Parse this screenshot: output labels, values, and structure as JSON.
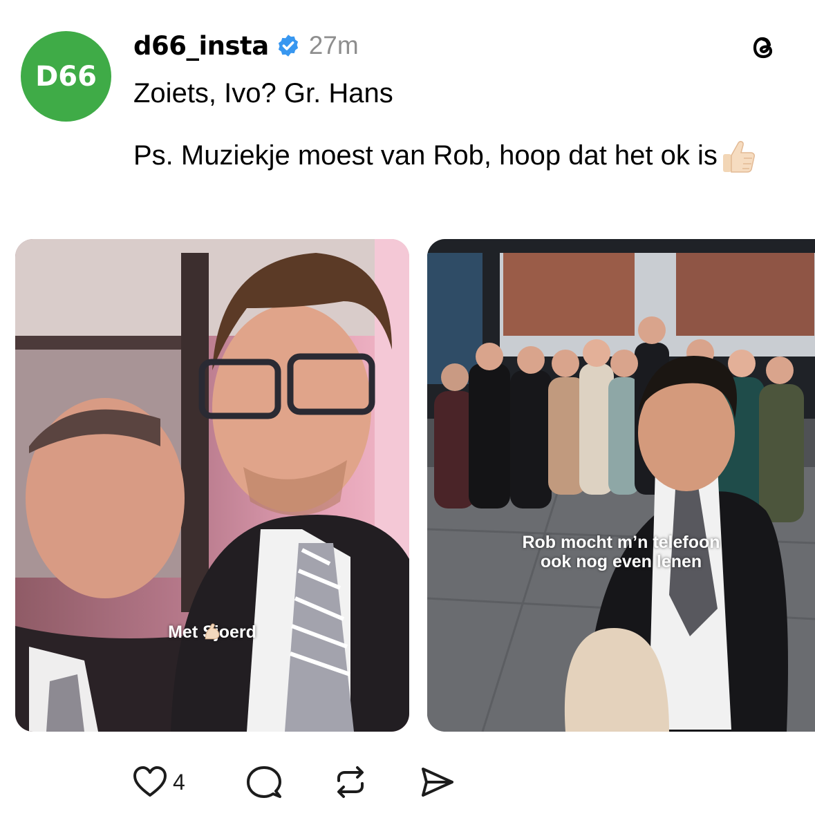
{
  "post": {
    "avatar_text": "D66",
    "avatar_color": "#3fab47",
    "username": "d66_insta",
    "verified_icon": "verified-badge-icon",
    "verified_color": "#3897f0",
    "time": "27m",
    "app_icon": "threads-logo-icon",
    "caption_line1": "Zoiets, Ivo? Gr. Hans",
    "caption_line2": "Ps. Muziekje moest van Rob, hoop dat het ok is",
    "caption_emoji": "thumbs-up-emoji"
  },
  "media": [
    {
      "overlay": "Met Sjoerd",
      "overlay_emoji": "flexed-biceps-emoji"
    },
    {
      "overlay_line1": "Rob mocht m’n telefoon",
      "overlay_line2": "ook nog even lenen"
    }
  ],
  "actions": {
    "like_icon": "heart-icon",
    "like_count": "4",
    "reply_icon": "comment-icon",
    "repost_icon": "repost-icon",
    "share_icon": "send-icon"
  }
}
